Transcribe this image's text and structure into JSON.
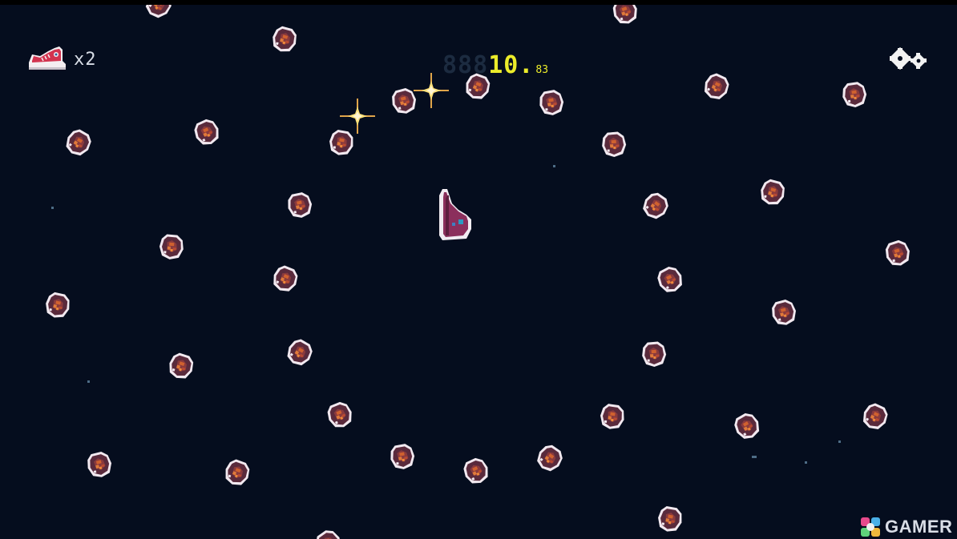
{
  "hud": {
    "lives_icon": "red-sneaker-icon",
    "lives_count": "x2",
    "timer_ghost": "888",
    "timer_value": "10.",
    "timer_fraction": "83",
    "settings_icon": "gear-icon"
  },
  "watermark": {
    "text": "GAMER"
  },
  "colors": {
    "background": "#050d1e",
    "timer": "#ecec2a",
    "asteroid_outline": "#f2e9f0",
    "asteroid_body": "#5a2a3c",
    "asteroid_core": "#d0612f",
    "player": "#8b2f5c",
    "sparkle": "#ffe17a"
  }
}
